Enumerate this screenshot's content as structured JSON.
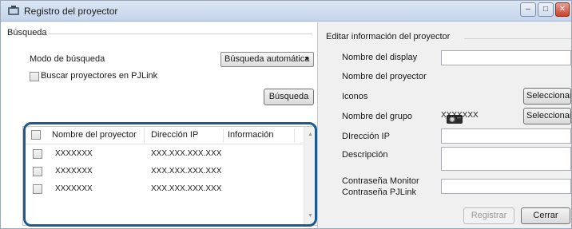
{
  "window": {
    "title": "Registro del proyector",
    "controls": {
      "minimize": "‒",
      "maximize": "□",
      "close": "✕"
    }
  },
  "search": {
    "group_label": "Búsqueda",
    "mode_label": "Modo de búsqueda",
    "mode_value": "Búsqueda automática",
    "pjlink_label": "Buscar proyectores en PJLink",
    "search_button": "Búsqueda"
  },
  "list": {
    "columns": [
      "Nombre del proyector",
      "Dirección IP",
      "Información"
    ],
    "rows": [
      {
        "name": "XXXXXXX",
        "ip": "XXX.XXX.XXX.XXX",
        "info": ""
      },
      {
        "name": "XXXXXXX",
        "ip": "XXX.XXX.XXX.XXX",
        "info": ""
      },
      {
        "name": "XXXXXXX",
        "ip": "XXX.XXX.XXX.XXX",
        "info": ""
      }
    ]
  },
  "edit": {
    "group_label": "Editar información del proyector",
    "display_name_label": "Nombre del display",
    "display_name_value": "",
    "projector_name_label": "Nombre del proyector",
    "icons_label": "Iconos",
    "select_button": "Seleccionar..",
    "group_name_label": "Nombre del grupo",
    "group_name_value": "XXXXXXX",
    "ip_label": "DIrección IP",
    "description_label": "Descripción",
    "monitor_password_label": "Contraseña Monitor",
    "pjlink_password_label": "Contraseña PJLink",
    "register_button": "Registrar",
    "close_button": "Cerrar"
  },
  "colors": {
    "highlight_border": "#1d5a8f",
    "titlebar": "#c4d5ea",
    "close_button": "#c9412a"
  },
  "icons": [
    "projector-manager-icon",
    "projector-icon",
    "chevron-down-icon",
    "scroll-up-arrow-icon",
    "scroll-down-arrow-icon"
  ]
}
